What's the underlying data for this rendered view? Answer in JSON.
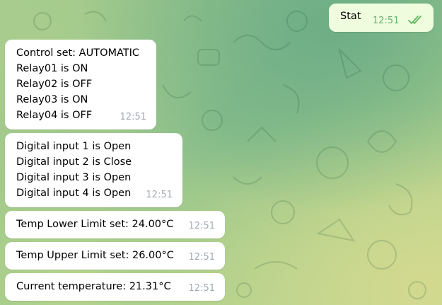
{
  "outgoing": {
    "text": "Stat",
    "time": "12:51",
    "status_icon": "double-check-icon",
    "status_color": "#5fb65f"
  },
  "messages": [
    {
      "lines": [
        "Control set: AUTOMATIC",
        "Relay01 is ON",
        "Relay02 is OFF",
        "Relay03 is ON",
        "Relay04 is OFF"
      ],
      "time": "12:51"
    },
    {
      "lines": [
        "Digital input 1 is Open",
        "Digital input 2 is Close",
        "Digital input 3 is Open",
        "Digital input 4 is Open"
      ],
      "time": "12:51"
    },
    {
      "lines": [
        "Temp Lower Limit set: 24.00°C"
      ],
      "time": "12:51"
    },
    {
      "lines": [
        "Temp Upper Limit set: 26.00°C"
      ],
      "time": "12:51"
    },
    {
      "lines": [
        "Current temperature: 21.31°C"
      ],
      "time": "12:51"
    }
  ],
  "colors": {
    "incoming_bubble": "#ffffff",
    "outgoing_bubble": "#effdde",
    "time_incoming": "#a1aab3",
    "time_outgoing": "#6cae6b"
  }
}
